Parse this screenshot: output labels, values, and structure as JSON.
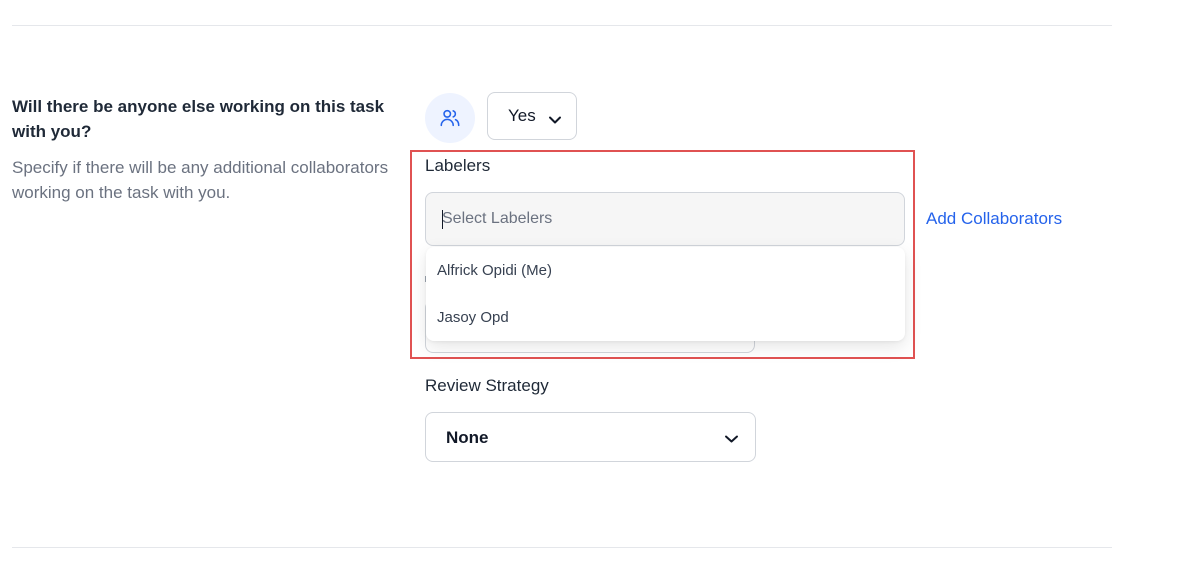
{
  "question": {
    "title": "Will there be anyone else working on this task with you?",
    "description": "Specify if there will be any additional collaborators working on the task with you."
  },
  "collaborators_toggle": {
    "icon": "users-icon",
    "selected": "Yes"
  },
  "labelers": {
    "label": "Labelers",
    "placeholder": "Select Labelers",
    "options": [
      "Alfrick Opidi (Me)",
      "Jasoy Opd"
    ]
  },
  "add_collaborators_link": "Add Collaborators",
  "review_strategy": {
    "label": "Review Strategy",
    "selected": "None"
  },
  "colors": {
    "accent": "#2563eb",
    "highlight_border": "#e05252"
  }
}
